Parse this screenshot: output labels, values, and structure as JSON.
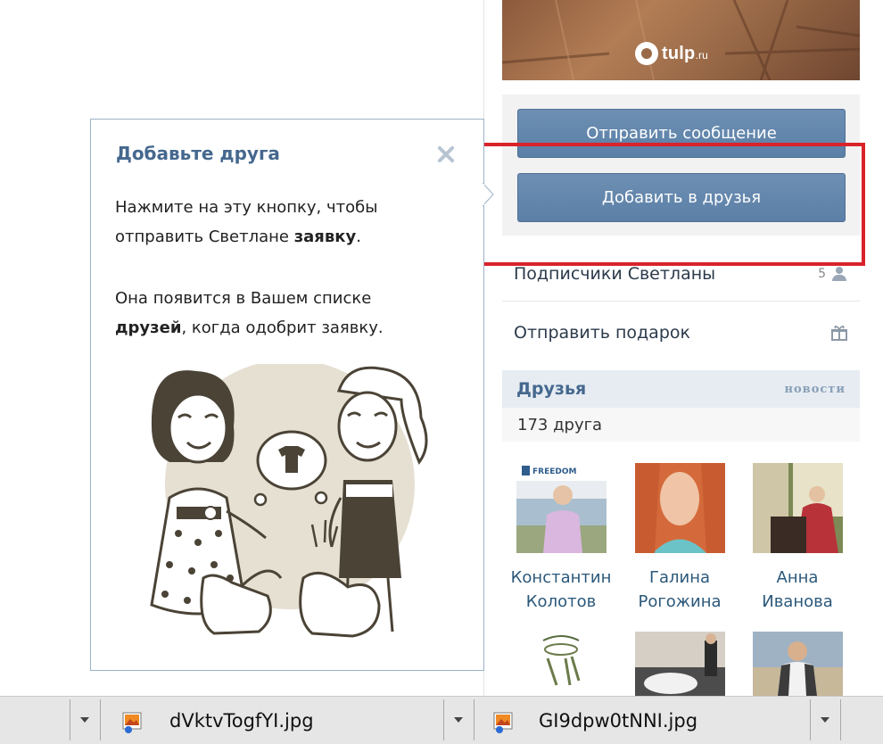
{
  "profile": {
    "watermark": "tulp",
    "watermark_suffix": ".ru"
  },
  "actions": {
    "send_message": "Отправить сообщение",
    "add_friend": "Добавить в друзья"
  },
  "menu": {
    "followers_label": "Подписчики Светланы",
    "followers_count": "5",
    "send_gift": "Отправить подарок"
  },
  "friends": {
    "title": "Друзья",
    "news_link": "новости",
    "count_text": "173 друга",
    "items": [
      {
        "first": "Константин",
        "last": "Колотов"
      },
      {
        "first": "Галина",
        "last": "Рогожина"
      },
      {
        "first": "Анна",
        "last": "Иванова"
      }
    ],
    "photo_caption": "FREEDOM"
  },
  "tooltip": {
    "title": "Добавьте друга",
    "p1_a": "Нажмите на эту кнопку, чтобы",
    "p1_b": "отправить Светлане ",
    "p1_bold": "заявку",
    "p1_end": ".",
    "p2_a": "Она появится в Вашем списке",
    "p2_bold": "друзей",
    "p2_b": ", когда одобрит заявку."
  },
  "taskbar": {
    "file1": "dVktvTogfYI.jpg",
    "file2": "GI9dpw0tNNI.jpg"
  },
  "colors": {
    "button": "#5b7fa6",
    "highlight": "#d9232a",
    "link": "#45688e"
  }
}
